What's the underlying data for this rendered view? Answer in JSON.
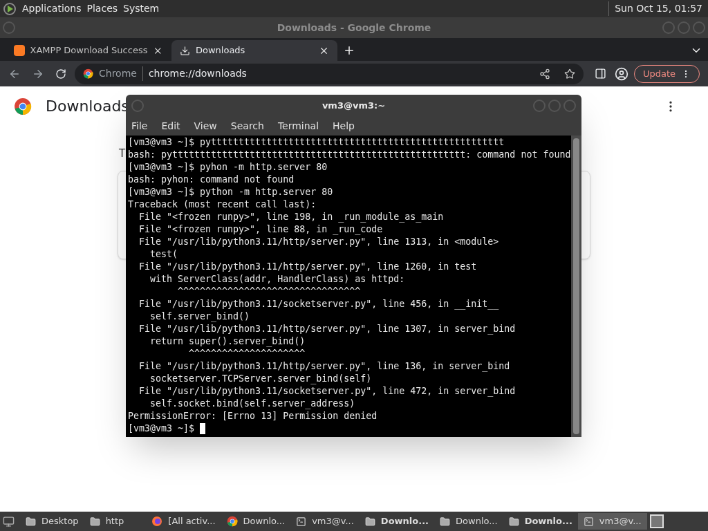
{
  "top_panel": {
    "menus": [
      "Applications",
      "Places",
      "System"
    ],
    "clock": "Sun Oct 15, 01:57"
  },
  "browser": {
    "title": "Downloads - Google Chrome",
    "tabs": [
      {
        "label": "XAMPP Download Success",
        "kind": "xampp",
        "selected": false
      },
      {
        "label": "Downloads",
        "kind": "download",
        "selected": true
      }
    ],
    "site_chip": "Chrome",
    "url": "chrome://downloads",
    "update_button": "Update",
    "page": {
      "heading": "Downloads",
      "partial_text": "T"
    }
  },
  "terminal": {
    "title": "vm3@vm3:~",
    "menu": [
      "File",
      "Edit",
      "View",
      "Search",
      "Terminal",
      "Help"
    ],
    "lines": [
      "[vm3@vm3 ~]$ pyttttttttttttttttttttttttttttttttttttttttttttttttttttt",
      "bash: pyttttttttttttttttttttttttttttttttttttttttttttttttttttt: command not found",
      "[vm3@vm3 ~]$ pyhon -m http.server 80",
      "bash: pyhon: command not found",
      "[vm3@vm3 ~]$ python -m http.server 80",
      "Traceback (most recent call last):",
      "  File \"<frozen runpy>\", line 198, in _run_module_as_main",
      "  File \"<frozen runpy>\", line 88, in _run_code",
      "  File \"/usr/lib/python3.11/http/server.py\", line 1313, in <module>",
      "    test(",
      "  File \"/usr/lib/python3.11/http/server.py\", line 1260, in test",
      "    with ServerClass(addr, HandlerClass) as httpd:",
      "         ^^^^^^^^^^^^^^^^^^^^^^^^^^^^^^^^^",
      "  File \"/usr/lib/python3.11/socketserver.py\", line 456, in __init__",
      "    self.server_bind()",
      "  File \"/usr/lib/python3.11/http/server.py\", line 1307, in server_bind",
      "    return super().server_bind()",
      "           ^^^^^^^^^^^^^^^^^^^^^",
      "  File \"/usr/lib/python3.11/http/server.py\", line 136, in server_bind",
      "    socketserver.TCPServer.server_bind(self)",
      "  File \"/usr/lib/python3.11/socketserver.py\", line 472, in server_bind",
      "    self.socket.bind(self.server_address)",
      "PermissionError: [Errno 13] Permission denied"
    ],
    "prompt": "[vm3@vm3 ~]$",
    "cursor": true
  },
  "taskbar": {
    "items": [
      {
        "label": "Desktop",
        "kind": "folder",
        "bold": false,
        "selected": false
      },
      {
        "label": "http",
        "kind": "folder",
        "bold": false,
        "selected": false
      },
      {
        "label": "[All activ...",
        "kind": "firefox",
        "bold": false,
        "selected": false
      },
      {
        "label": "Downlo...",
        "kind": "chrome",
        "bold": false,
        "selected": false
      },
      {
        "label": "vm3@v...",
        "kind": "terminal",
        "bold": false,
        "selected": false
      },
      {
        "label": "Downlo...",
        "kind": "folder",
        "bold": true,
        "selected": false
      },
      {
        "label": "Downlo...",
        "kind": "folder",
        "bold": false,
        "selected": false
      },
      {
        "label": "Downlo...",
        "kind": "folder",
        "bold": true,
        "selected": false
      },
      {
        "label": "vm3@v...",
        "kind": "terminal",
        "bold": false,
        "selected": true
      }
    ]
  }
}
